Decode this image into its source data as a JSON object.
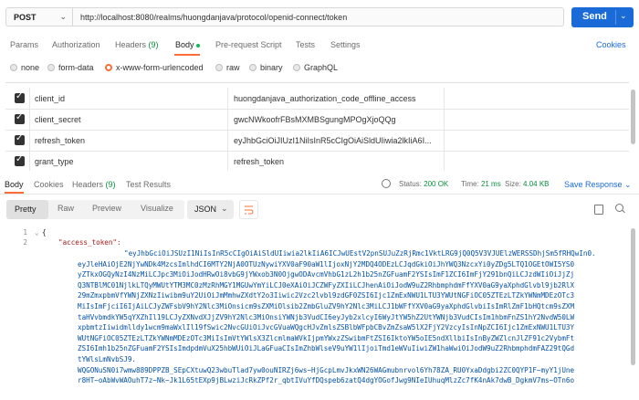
{
  "request": {
    "method": "POST",
    "url": "http://localhost:8080/realms/huongdanjava/protocol/openid-connect/token",
    "send_label": "Send"
  },
  "request_tabs": [
    {
      "label": "Params"
    },
    {
      "label": "Authorization"
    },
    {
      "label": "Headers",
      "count": "(9)"
    },
    {
      "label": "Body"
    },
    {
      "label": "Pre-request Script"
    },
    {
      "label": "Tests"
    },
    {
      "label": "Settings"
    }
  ],
  "cookies_label": "Cookies",
  "body_types": [
    {
      "label": "none",
      "selected": false
    },
    {
      "label": "form-data",
      "selected": false
    },
    {
      "label": "x-www-form-urlencoded",
      "selected": true
    },
    {
      "label": "raw",
      "selected": false
    },
    {
      "label": "binary",
      "selected": false
    },
    {
      "label": "GraphQL",
      "selected": false
    }
  ],
  "params": [
    {
      "key": "client_id",
      "value": "huongdanjava_authorization_code_offline_access",
      "checked": true
    },
    {
      "key": "client_secret",
      "value": "gwcNWkoofrFBsMXMBSgungMPOgXjoQQg",
      "checked": true
    },
    {
      "key": "refresh_token",
      "value": "eyJhbGciOiJIUzI1NiIsInR5cCIgOiAiSldUIiwia2lkIiA6I...",
      "checked": true
    },
    {
      "key": "grant_type",
      "value": "refresh_token",
      "checked": true
    }
  ],
  "response_tabs": [
    {
      "label": "Body"
    },
    {
      "label": "Cookies"
    },
    {
      "label": "Headers",
      "count": "(9)"
    },
    {
      "label": "Test Results"
    }
  ],
  "status": {
    "status_label": "Status:",
    "status_value": "200 OK",
    "time_label": "Time:",
    "time_value": "21 ms",
    "size_label": "Size:",
    "size_value": "4.04 KB"
  },
  "save_response_label": "Save Response",
  "view_modes": [
    "Pretty",
    "Raw",
    "Preview",
    "Visualize"
  ],
  "format_select": "JSON",
  "code": {
    "line_numbers": [
      "1",
      "2"
    ],
    "open_brace": "{",
    "key": "\"access_token\":",
    "token_lines": [
      "\"eyJhbGciOiJSUzI1NiIsInR5cCIgOiAiSldUIiwia2lkIiA6ICJwUEstV2pnSUJuZzRjRmc1VktLRG9jQ0Q5V3VJUElzWERSSDhjSm5fRHQwIn0.",
      "eyJleHAiOjE2NjYwNDk4MzcsImlhdCI6MTY2NjA0OTUzNywiYXV0aF90aW1lIjoxNjY2MDQ4ODEzLCJqdGkiOiJhYWQ3NzcxYi0yZDg5LTQ1OGEtOWI5YS0",
      "yZTkxOGQyNzI4NzMiLCJpc3MiOiJodHRwOi8vbG9jYWxob3N0OjgwODAvcmVhbG1zL2h1b25nZGFuamF2YSIsImF1ZCI6ImFjY291bnQiLCJzdWIiOiJjZj",
      "Q3NTBlMC01NjlkLTQyMWUtYTM3MC0zMzRhMGY1MGUwYmYiLCJ0eXAiOiJCZWFyZXIiLCJhenAiOiJodW9uZ2RhbmphdmFfYXV0aG9yaXphdGlvbl9jb2RlX",
      "29mZmxpbmVfYWNjZXNzIiwibm9uY2UiOiJmMmhwZXdtY2o3Iiwic2Vzc2lvbl9zdGF0ZSI6Ijc1ZmExNWU1LTU3YWUtNGFiOC05ZTEzLTZkYWNmMDEzOTc3",
      "MiIsImFjciI6IjAiLCJyZWFsbV9hY2Nlc3MiOnsicm9sZXMiOlsib2ZmbGluZV9hY2Nlc3MiLCJ1bWFfYXV0aG9yaXphdGlvbiIsImRlZmF1bHQtcm9sZXM",
      "taHVvbmdkYW5qYXZhIl19LCJyZXNvdXJjZV9hY2Nlc3MiOnsiYWNjb3VudCI6eyJyb2xlcyI6WyJtYW5hZ2UtYWNjb3VudCIsIm1hbmFnZS1hY2NvdW50LW",
      "xpbmtzIiwidmlldy1wcm9maWxlIl19fSwic2NvcGUiOiJvcGVuaWQgcHJvZmlsZSBlbWFpbCBvZmZsaW5lX2FjY2VzcyIsInNpZCI6Ijc1ZmExNWU1LTU3Y",
      "WUtNGFiOC05ZTEzLTZkYWNmMDEzOTc3MiIsImVtYWlsX3ZlcmlmaWVkIjpmYWxzZSwibmFtZSI6IktoYW5oIE5ndXllbiIsInByZWZlcnJlZF91c2VybmFt",
      "ZSI6Imh1b25nZGFuamF2YSIsImdpdmVuX25hbWUiOiJLaGFuaCIsImZhbWlseV9uYW1lIjoiTmd1eWVuIiwiZW1haWwiOiJodW9uZ2RhbmphdmFAZ29tQGd",
      "tYWlsLmNvbSJ9.",
      "WQGONuSN0i7wmw889DPPZB_SEpCXtuwQ23wbuTlad7yw0ouNIRZj6ws~HjGcpLmvJkxWN26WAGmubnrvol6Yh78ZA_RU0YxaDdgbi2ZC0QYP1F~myY1jUne",
      "r8HT~oAbWvWAOuhT7z~Nk~Jk1L65tEXp9jBLwziJcRkZPf2r_qbtIVuYfDQspeb6zatQ4dgYOGofJwg9NIeIUhuqMlzZc7fK4nAk7dwB_DgkmV7ms~OTn6o"
    ]
  }
}
